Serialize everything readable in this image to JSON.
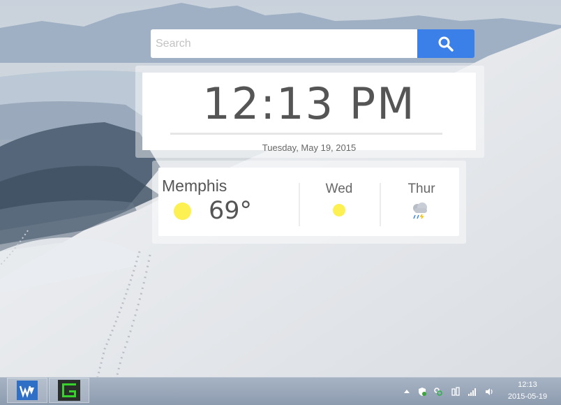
{
  "search": {
    "placeholder": "Search",
    "button_icon": "magnifier-icon"
  },
  "clock": {
    "time": "12:13 PM",
    "date": "Tuesday, May 19, 2015"
  },
  "weather": {
    "city": "Memphis",
    "current_temp": "69°",
    "current_icon": "sun-icon",
    "forecast": [
      {
        "day": "Wed",
        "icon": "sun-icon"
      },
      {
        "day": "Thur",
        "icon": "rain-cloud-icon"
      }
    ]
  },
  "taskbar": {
    "apps": [
      {
        "icon": "wps-office-icon"
      },
      {
        "icon": "green-terminal-icon"
      }
    ],
    "tray_icons": [
      "show-hidden-icons-arrow",
      "security-shield-icon",
      "link-icon",
      "power-plug-icon",
      "signal-bars-icon",
      "volume-icon"
    ],
    "time": "12:13",
    "date": "2015-05-19"
  },
  "colors": {
    "search_button": "#3b80e8",
    "sun": "#fdf052",
    "taskbar": "#98a6b8"
  }
}
